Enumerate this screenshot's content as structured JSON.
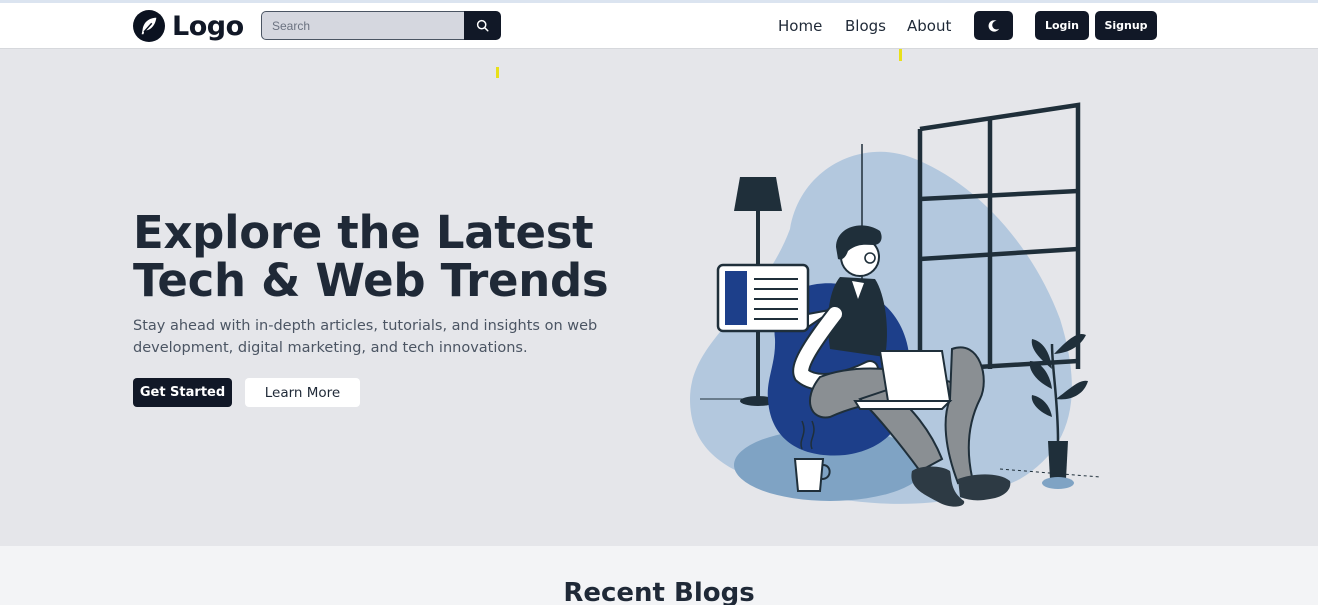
{
  "brand": {
    "logo_text": "Logo",
    "logo_icon": "feather-icon"
  },
  "search": {
    "placeholder": "Search",
    "value": "",
    "button_icon": "search-icon"
  },
  "nav": {
    "links": [
      "Home",
      "Blogs",
      "About"
    ],
    "theme_toggle_icon": "moon-icon",
    "login_label": "Login",
    "signup_label": "Signup"
  },
  "hero": {
    "title": "Explore the Latest Tech & Web Trends",
    "subtitle": "Stay ahead with in-depth articles, tutorials, and insights on web development, digital marketing, and tech innovations.",
    "primary_cta": "Get Started",
    "secondary_cta": "Learn More"
  },
  "recent": {
    "title": "Recent Blogs"
  },
  "colors": {
    "primary": "#111827",
    "hero_bg": "#e5e6ea",
    "illustration_blue": "#1d3f8a",
    "illustration_light_blue": "#b3c8de",
    "accent_yellow": "#e8e01a"
  }
}
